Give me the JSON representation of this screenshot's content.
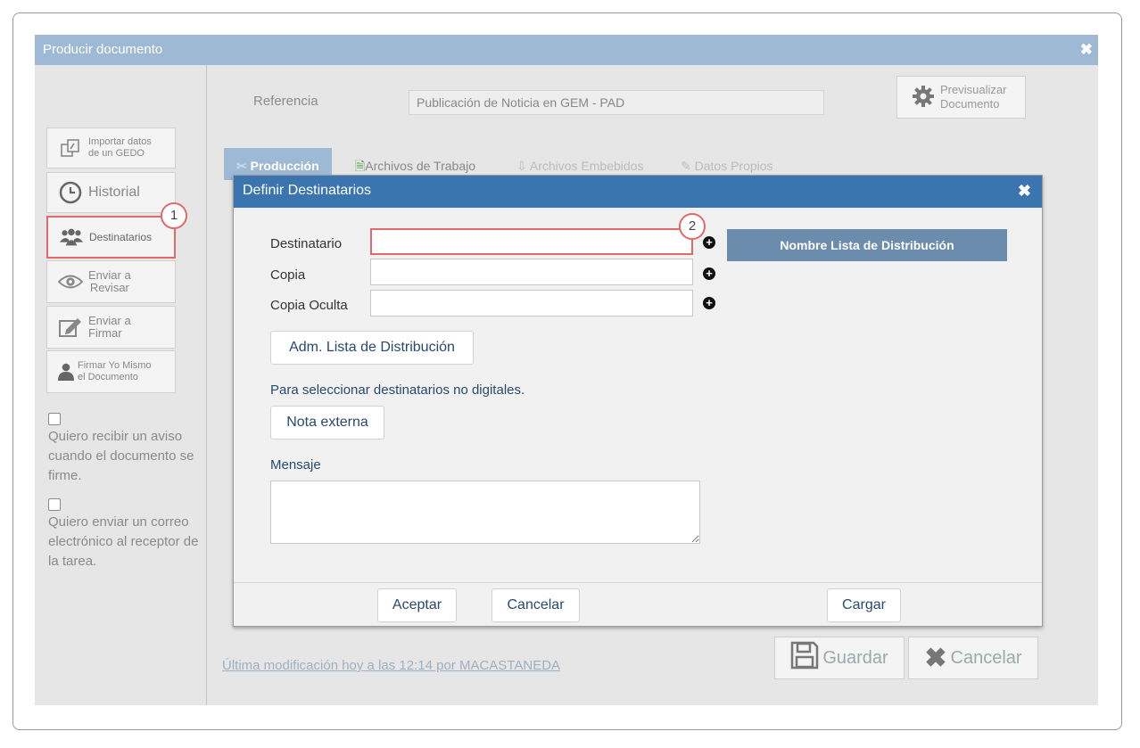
{
  "window": {
    "title": "Producir documento"
  },
  "sidebar": {
    "import": {
      "line1": "Importar datos",
      "line2": "de un GEDO"
    },
    "historial": "Historial",
    "destinatarios": "Destinatarios",
    "enviar_revisar": {
      "line1": "Enviar a",
      "line2": "Revisar"
    },
    "enviar_firmar": {
      "line1": "Enviar a",
      "line2": "Firmar"
    },
    "firmar_yo": {
      "line1": "Firmar Yo Mismo",
      "line2": "el Documento"
    },
    "checkbox1": "Quiero recibir un aviso cuando el documento se firme.",
    "checkbox2": "Quiero enviar un correo electrónico al receptor de la tarea."
  },
  "badges": {
    "b1": "1",
    "b2": "2"
  },
  "header": {
    "referencia_label": "Referencia",
    "referencia_value": "Publicación de Noticia en GEM - PAD",
    "preview": {
      "line1": "Previsualizar",
      "line2": "Documento"
    }
  },
  "tabs": [
    {
      "label": "Producción"
    },
    {
      "label": "Archivos de Trabajo"
    },
    {
      "label": "Archivos Embebidos"
    },
    {
      "label": "Datos Propios"
    }
  ],
  "footer": {
    "last_modified": "Última modificación hoy a las 12:14 por MACASTANEDA",
    "guardar": "Guardar",
    "cancelar": "Cancelar"
  },
  "modal": {
    "title": "Definir Destinatarios",
    "destinatario_label": "Destinatario",
    "copia_label": "Copia",
    "copia_oculta_label": "Copia Oculta",
    "destinatario_value": "",
    "copia_value": "",
    "copia_oculta_value": "",
    "dist_header": "Nombre Lista de Distribución",
    "adm_button": "Adm. Lista de Distribución",
    "no_digital_text": "Para seleccionar destinatarios no digitales.",
    "nota_button": "Nota externa",
    "mensaje_label": "Mensaje",
    "mensaje_value": "",
    "aceptar": "Aceptar",
    "cancelar": "Cancelar",
    "cargar": "Cargar"
  }
}
